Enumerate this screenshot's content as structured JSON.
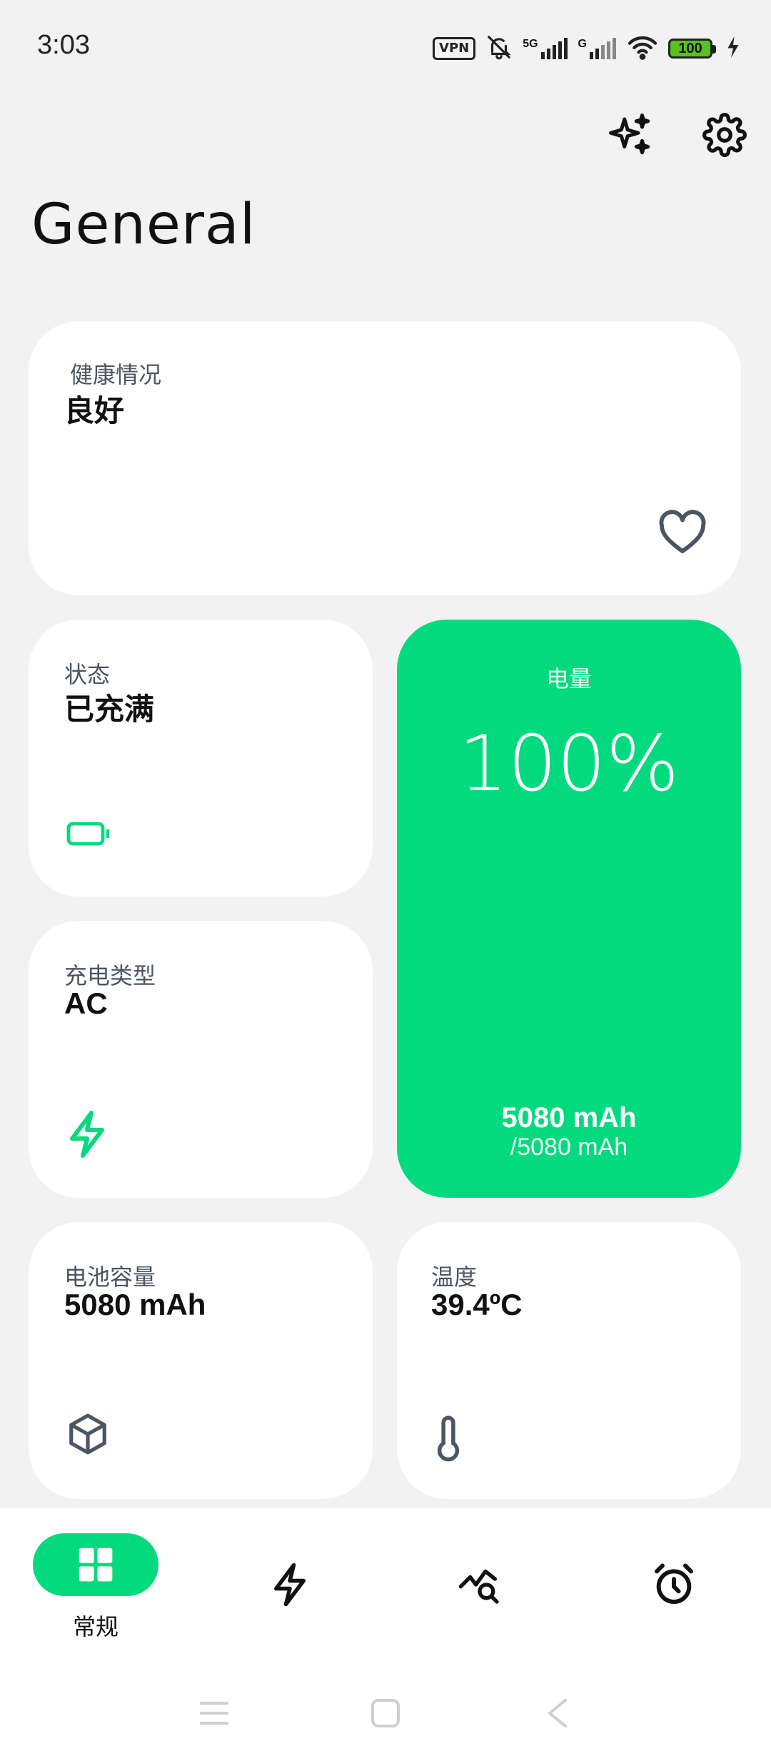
{
  "status_bar": {
    "time": "3:03",
    "vpn": "VPN",
    "net1": "5G",
    "net2": "G",
    "battery": "100"
  },
  "header": {
    "title": "General"
  },
  "cards": {
    "health": {
      "label": "健康情况",
      "value": "良好",
      "icon": "heart-icon"
    },
    "status": {
      "label": "状态",
      "value": "已充满",
      "icon": "battery-icon"
    },
    "charge_type": {
      "label": "充电类型",
      "value": "AC",
      "icon": "bolt-icon"
    },
    "level": {
      "label": "电量",
      "percent": "100%",
      "current": "5080 mAh",
      "total": "/5080 mAh"
    },
    "capacity": {
      "label": "电池容量",
      "value": "5080 mAh",
      "icon": "cube-icon"
    },
    "temperature": {
      "label": "温度",
      "value": "39.4ºC",
      "icon": "thermometer-icon"
    }
  },
  "bottom_nav": {
    "items": [
      {
        "label": "常规",
        "icon": "dashboard-icon",
        "active": true
      },
      {
        "icon": "bolt-icon"
      },
      {
        "icon": "chart-search-icon"
      },
      {
        "icon": "alarm-icon"
      }
    ]
  },
  "colors": {
    "accent": "#02da7d",
    "background": "#f2f2f2",
    "card": "#ffffff"
  }
}
